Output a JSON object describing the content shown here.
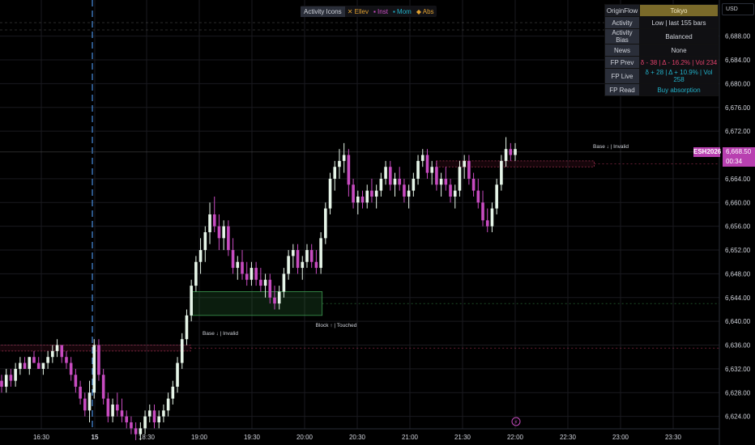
{
  "chart_data": {
    "type": "candlestick",
    "symbol": "ESH2026",
    "currency": "USD",
    "last_price": "6,668.50",
    "countdown": "00:34",
    "y_ticks": [
      "6,688.00",
      "6,684.00",
      "6,680.00",
      "6,676.00",
      "6,672.00",
      "6,664.00",
      "6,660.00",
      "6,656.00",
      "6,652.00",
      "6,648.00",
      "6,644.00",
      "6,640.00",
      "6,636.00",
      "6,632.00",
      "6,628.00",
      "6,624.00"
    ],
    "ylim": [
      6623,
      6690
    ],
    "x_ticks": [
      "16:30",
      "15",
      "18:30",
      "19:00",
      "19:30",
      "20:00",
      "20:30",
      "21:00",
      "21:30",
      "22:00",
      "22:30",
      "23:00",
      "23:30"
    ],
    "zones": [
      {
        "label": "Base ↓ | Invalid",
        "y_top": 6636,
        "y_bot": 6635,
        "x_start": "16:45",
        "x_end": "18:55",
        "style": "bear"
      },
      {
        "label": "Block ↑ | Touched",
        "y_top": 6645,
        "y_bot": 6641,
        "x_start": "18:55",
        "x_end": "20:10",
        "style": "bull"
      },
      {
        "label": "Base ↓ | Invalid",
        "y_top": 6667,
        "y_bot": 6666,
        "x_start": "21:15",
        "x_end": "22:45",
        "style": "bear"
      }
    ],
    "ohlc": [
      [
        6630,
        6631,
        6628,
        6629
      ],
      [
        6629,
        6632,
        6628,
        6631
      ],
      [
        6631,
        6632,
        6629,
        6630
      ],
      [
        6630,
        6633,
        6629,
        6632
      ],
      [
        6632,
        6634,
        6631,
        6633
      ],
      [
        6633,
        6634,
        6632,
        6632
      ],
      [
        6632,
        6634,
        6631,
        6634
      ],
      [
        6634,
        6635,
        6633,
        6633
      ],
      [
        6633,
        6634,
        6632,
        6632
      ],
      [
        6632,
        6633,
        6631,
        6633
      ],
      [
        6633,
        6635,
        6632,
        6634
      ],
      [
        6634,
        6636,
        6633,
        6635
      ],
      [
        6635,
        6637,
        6634,
        6636
      ],
      [
        6636,
        6636,
        6633,
        6634
      ],
      [
        6634,
        6635,
        6632,
        6633
      ],
      [
        6633,
        6634,
        6630,
        6631
      ],
      [
        6631,
        6632,
        6628,
        6629
      ],
      [
        6629,
        6630,
        6626,
        6627
      ],
      [
        6627,
        6628,
        6624,
        6625
      ],
      [
        6625,
        6630,
        6623,
        6628
      ],
      [
        6628,
        6637,
        6627,
        6636
      ],
      [
        6636,
        6637,
        6630,
        6631
      ],
      [
        6631,
        6632,
        6626,
        6627
      ],
      [
        6627,
        6628,
        6623,
        6624
      ],
      [
        6624,
        6627,
        6623,
        6626
      ],
      [
        6626,
        6628,
        6624,
        6625
      ],
      [
        6625,
        6627,
        6623,
        6624
      ],
      [
        6624,
        6625,
        6622,
        6623
      ],
      [
        6623,
        6624,
        6621,
        6622
      ],
      [
        6622,
        6623,
        6620,
        6621
      ],
      [
        6621,
        6623,
        6620,
        6622
      ],
      [
        6622,
        6625,
        6621,
        6624
      ],
      [
        6624,
        6626,
        6623,
        6625
      ],
      [
        6625,
        6626,
        6622,
        6623
      ],
      [
        6623,
        6625,
        6622,
        6624
      ],
      [
        6624,
        6626,
        6623,
        6625
      ],
      [
        6625,
        6628,
        6624,
        6627
      ],
      [
        6627,
        6630,
        6626,
        6629
      ],
      [
        6629,
        6634,
        6628,
        6633
      ],
      [
        6633,
        6638,
        6632,
        6637
      ],
      [
        6637,
        6642,
        6636,
        6641
      ],
      [
        6641,
        6647,
        6640,
        6646
      ],
      [
        6646,
        6651,
        6645,
        6650
      ],
      [
        6650,
        6654,
        6648,
        6652
      ],
      [
        6652,
        6656,
        6650,
        6655
      ],
      [
        6655,
        6660,
        6653,
        6658
      ],
      [
        6658,
        6661,
        6655,
        6656
      ],
      [
        6656,
        6658,
        6652,
        6654
      ],
      [
        6654,
        6657,
        6652,
        6656
      ],
      [
        6656,
        6657,
        6651,
        6652
      ],
      [
        6652,
        6654,
        6648,
        6649
      ],
      [
        6649,
        6651,
        6647,
        6650
      ],
      [
        6650,
        6652,
        6647,
        6648
      ],
      [
        6648,
        6650,
        6646,
        6647
      ],
      [
        6647,
        6650,
        6646,
        6649
      ],
      [
        6649,
        6650,
        6646,
        6647
      ],
      [
        6647,
        6649,
        6645,
        6646
      ],
      [
        6646,
        6648,
        6644,
        6647
      ],
      [
        6647,
        6648,
        6643,
        6644
      ],
      [
        6644,
        6646,
        6642,
        6643
      ],
      [
        6643,
        6646,
        6642,
        6645
      ],
      [
        6645,
        6649,
        6644,
        6648
      ],
      [
        6648,
        6652,
        6647,
        6651
      ],
      [
        6651,
        6653,
        6649,
        6652
      ],
      [
        6652,
        6653,
        6648,
        6649
      ],
      [
        6649,
        6651,
        6647,
        6650
      ],
      [
        6650,
        6653,
        6649,
        6652
      ],
      [
        6652,
        6653,
        6649,
        6650
      ],
      [
        6650,
        6652,
        6648,
        6649
      ],
      [
        6649,
        6655,
        6648,
        6654
      ],
      [
        6654,
        6660,
        6653,
        6659
      ],
      [
        6659,
        6665,
        6658,
        6664
      ],
      [
        6664,
        6667,
        6662,
        6666
      ],
      [
        6666,
        6669,
        6664,
        6667
      ],
      [
        6667,
        6670,
        6665,
        6668
      ],
      [
        6668,
        6669,
        6661,
        6663
      ],
      [
        6663,
        6664,
        6659,
        6660
      ],
      [
        6660,
        6662,
        6658,
        6661
      ],
      [
        6661,
        6662,
        6659,
        6660
      ],
      [
        6660,
        6663,
        6659,
        6662
      ],
      [
        6662,
        6664,
        6660,
        6661
      ],
      [
        6661,
        6663,
        6659,
        6662
      ],
      [
        6662,
        6665,
        6661,
        6664
      ],
      [
        6664,
        6667,
        6663,
        6666
      ],
      [
        6666,
        6667,
        6662,
        6663
      ],
      [
        6663,
        6665,
        6661,
        6664
      ],
      [
        6664,
        6666,
        6662,
        6663
      ],
      [
        6663,
        6664,
        6660,
        6661
      ],
      [
        6661,
        6663,
        6659,
        6662
      ],
      [
        6662,
        6665,
        6661,
        6664
      ],
      [
        6664,
        6668,
        6663,
        6667
      ],
      [
        6667,
        6669,
        6666,
        6668
      ],
      [
        6668,
        6669,
        6664,
        6665
      ],
      [
        6665,
        6667,
        6663,
        6666
      ],
      [
        6666,
        6667,
        6662,
        6663
      ],
      [
        6663,
        6665,
        6661,
        6664
      ],
      [
        6664,
        6666,
        6662,
        6663
      ],
      [
        6663,
        6664,
        6660,
        6661
      ],
      [
        6661,
        6663,
        6659,
        6662
      ],
      [
        6662,
        6667,
        6661,
        6666
      ],
      [
        6666,
        6668,
        6664,
        6667
      ],
      [
        6667,
        6668,
        6663,
        6664
      ],
      [
        6664,
        6665,
        6661,
        6662
      ],
      [
        6662,
        6664,
        6659,
        6660
      ],
      [
        6660,
        6662,
        6656,
        6657
      ],
      [
        6657,
        6659,
        6655,
        6656
      ],
      [
        6656,
        6660,
        6655,
        6659
      ],
      [
        6659,
        6664,
        6658,
        6663
      ],
      [
        6663,
        6668,
        6662,
        6667
      ],
      [
        6667,
        6671,
        6666,
        6669
      ],
      [
        6669,
        6670,
        6667,
        6668
      ],
      [
        6668,
        6670,
        6667,
        6669
      ]
    ]
  },
  "header": {
    "legend_title": "Activity Icons",
    "legend_items": [
      {
        "icon": "✕",
        "label": "Ellev",
        "color": "#e0a030"
      },
      {
        "icon": "▪",
        "label": "Inst",
        "color": "#d050c8"
      },
      {
        "icon": "▪",
        "label": "Mom",
        "color": "#22b0c8"
      },
      {
        "icon": "◆",
        "label": "Abs",
        "color": "#e0a030"
      }
    ]
  },
  "info_panel": {
    "rows": [
      {
        "key": "OriginFlow",
        "value": "Tokyo",
        "value_color": "#f0e6c0"
      },
      {
        "key": "Activity",
        "value": "Low | last 155 bars",
        "value_color": "#d1d4dc"
      },
      {
        "key": "Activity Bias",
        "value": "Balanced",
        "value_color": "#d1d4dc"
      },
      {
        "key": "News",
        "value": "None",
        "value_color": "#d1d4dc"
      },
      {
        "key": "FP Prev",
        "value": "δ - 38 | Δ - 16.2% | Vol 234",
        "value_color": "#e0406a"
      },
      {
        "key": "FP Live",
        "value": "δ + 28 | Δ + 10.9% | Vol 258",
        "value_color": "#22b0c8"
      },
      {
        "key": "FP Read",
        "value": "Buy absorption",
        "value_color": "#22b0c8"
      }
    ]
  },
  "colors": {
    "bull": "#e6f5e8",
    "bear": "#c74bc0",
    "grid": "#1a1a1f",
    "axis_text": "#d1d4dc",
    "accent": "#b840b0"
  }
}
